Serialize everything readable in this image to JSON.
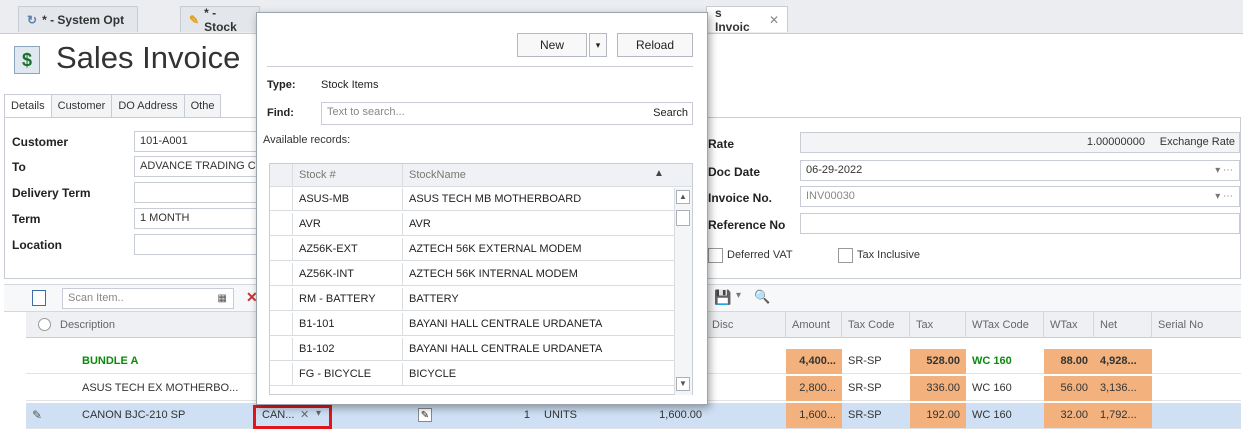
{
  "tabs": [
    {
      "label": "* - System Opt"
    },
    {
      "label": "* - Stock"
    },
    {
      "label": "s Invoic"
    }
  ],
  "header": {
    "title": "Sales Invoice",
    "icon_glyph": "$"
  },
  "subtabs": [
    "Details",
    "Customer",
    "DO Address",
    "Othe"
  ],
  "form": {
    "customer_label": "Customer",
    "customer_value": "101-A001",
    "to_label": "To",
    "to_value": "ADVANCE TRADING C",
    "delivery_label": "Delivery Term",
    "delivery_value": "",
    "term_label": "Term",
    "term_value": "1 MONTH",
    "location_label": "Location",
    "location_value": "",
    "rate_label": "Rate",
    "rate_value": "1.00000000",
    "exchange_rate_label": "Exchange Rate",
    "docdate_label": "Doc Date",
    "docdate_value": "06-29-2022",
    "invoice_label": "Invoice No.",
    "invoice_value": "INV00030",
    "reference_label": "Reference No",
    "reference_value": "",
    "deferred_vat_label": "Deferred VAT",
    "tax_inclusive_label": "Tax Inclusive"
  },
  "toolbar": {
    "scan_placeholder": "Scan Item.."
  },
  "grid": {
    "columns": [
      "Description",
      "Disc",
      "Amount",
      "Tax Code",
      "Tax",
      "WTax Code",
      "WTax",
      "Net",
      "Serial No"
    ],
    "rows": [
      {
        "description": "BUNDLE A",
        "amount": "4,400...",
        "tax_code": "SR-SP",
        "tax": "528.00",
        "wtax_code": "WC 160",
        "wtax": "88.00",
        "net": "4,928..."
      },
      {
        "description": "ASUS TECH EX MOTHERBO...",
        "amount": "2,800...",
        "tax_code": "SR-SP",
        "tax": "336.00",
        "wtax_code": "WC 160",
        "wtax": "56.00",
        "net": "3,136..."
      },
      {
        "description": "CANON BJC-210 SP",
        "item_code": "CAN...",
        "qty": "1",
        "uom": "UNITS",
        "price": "1,600.00",
        "amount": "1,600...",
        "tax_code": "SR-SP",
        "tax": "192.00",
        "wtax_code": "WC 160",
        "wtax": "32.00",
        "net": "1,792..."
      }
    ]
  },
  "popup": {
    "new_label": "New",
    "reload_label": "Reload",
    "type_label": "Type:",
    "type_value": "Stock Items",
    "find_label": "Find:",
    "find_placeholder": "Text to search...",
    "search_label": "Search",
    "available_label": "Available records:",
    "columns": [
      "Stock #",
      "StockName"
    ],
    "records": [
      {
        "stock": "ASUS-MB",
        "name": "ASUS TECH MB MOTHERBOARD"
      },
      {
        "stock": "AVR",
        "name": "AVR"
      },
      {
        "stock": "AZ56K-EXT",
        "name": "AZTECH 56K EXTERNAL MODEM"
      },
      {
        "stock": "AZ56K-INT",
        "name": "AZTECH 56K INTERNAL MODEM"
      },
      {
        "stock": "RM - BATTERY",
        "name": "BATTERY"
      },
      {
        "stock": "B1-101",
        "name": "BAYANI HALL CENTRALE URDANETA"
      },
      {
        "stock": "B1-102",
        "name": "BAYANI HALL CENTRALE URDANETA"
      },
      {
        "stock": "FG - BICYCLE",
        "name": "BICYCLE"
      }
    ]
  },
  "colors": {
    "accent_orange": "#f3b27d",
    "selection_blue": "#cfe0f5",
    "highlight_red": "#e0161b",
    "bundle_green": "#0c8a0c"
  }
}
